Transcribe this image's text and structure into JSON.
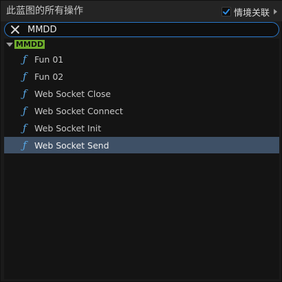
{
  "header": {
    "title": "此蓝图的所有操作",
    "context_label": "情境关联",
    "context_checked": true
  },
  "search": {
    "value": "MMDD",
    "placeholder": ""
  },
  "tree": {
    "category": "MMDD",
    "items": [
      {
        "label": "Fun 01",
        "icon": "function-icon"
      },
      {
        "label": "Fun 02",
        "icon": "function-icon"
      },
      {
        "label": "Web Socket Close",
        "icon": "function-icon"
      },
      {
        "label": "Web Socket Connect",
        "icon": "function-icon"
      },
      {
        "label": "Web Socket Init",
        "icon": "function-icon"
      },
      {
        "label": "Web Socket Send",
        "icon": "function-icon",
        "selected": true
      }
    ]
  },
  "colors": {
    "accent": "#2a7bd0",
    "category_highlight": "#6fae2c",
    "selection": "#3e5066",
    "function_icon": "#57a6e3"
  }
}
